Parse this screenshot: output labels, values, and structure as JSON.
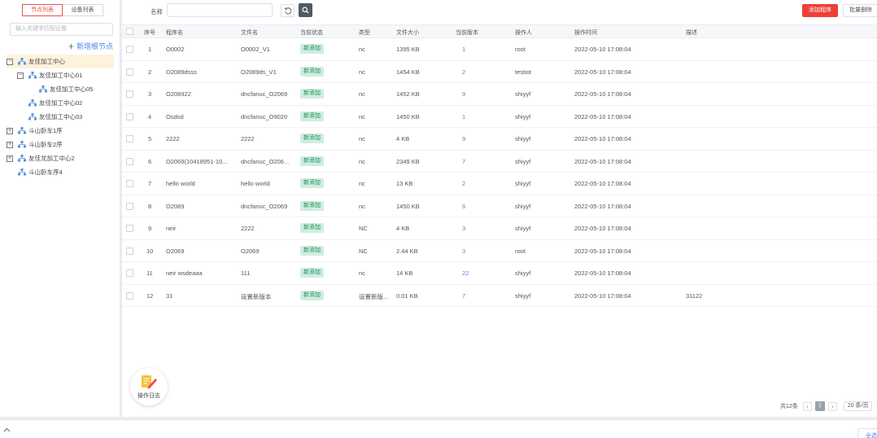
{
  "sidebar": {
    "tabs": [
      {
        "label": "节点列表",
        "active": true
      },
      {
        "label": "设备列表",
        "active": false
      }
    ],
    "search_placeholder": "输入关键字匹配设备",
    "add_root_label": "新增根节点",
    "tree": [
      {
        "label": "友佳加工中心",
        "level": 0,
        "toggle": "−",
        "selected": true
      },
      {
        "label": "友佳加工中心01",
        "level": 1,
        "toggle": "−",
        "selected": false
      },
      {
        "label": "友佳加工中心05",
        "level": 2,
        "toggle": "",
        "selected": false
      },
      {
        "label": "友佳加工中心02",
        "level": 1,
        "toggle": "",
        "selected": false
      },
      {
        "label": "友佳加工中心03",
        "level": 1,
        "toggle": "",
        "selected": false
      },
      {
        "label": "斗山卧车1序",
        "level": 0,
        "toggle": "+",
        "selected": false
      },
      {
        "label": "斗山卧车2序",
        "level": 0,
        "toggle": "+",
        "selected": false
      },
      {
        "label": "友佳龙加工中心2",
        "level": 0,
        "toggle": "+",
        "selected": false
      },
      {
        "label": "斗山卧车序4",
        "level": 0,
        "toggle": "",
        "selected": false
      }
    ]
  },
  "toolbar": {
    "name_label": "名称",
    "name_value": "",
    "add_program_label": "添加程序",
    "batch_delete_label": "批量删除"
  },
  "table": {
    "headers": [
      "序号",
      "程序名",
      "文件名",
      "当前状态",
      "类型",
      "文件大小",
      "当前版本",
      "操作人",
      "操作时间",
      "描述"
    ],
    "rows": [
      [
        "1",
        "O0002",
        "O0002_V1",
        "新添加",
        "nc",
        "1395 KB",
        "1",
        "root",
        "2022-05-10 17:08:04",
        ""
      ],
      [
        "2",
        "O2089dsss",
        "O2089ds_V1",
        "新添加",
        "nc",
        "1454 KB",
        "2",
        "testiot",
        "2022-05-10 17:08:04",
        ""
      ],
      [
        "3",
        "O208922",
        "dncfanuc_O2069",
        "新添加",
        "nc",
        "1452 KB",
        "9",
        "shiyyf",
        "2022-05-10 17:08:04",
        ""
      ],
      [
        "4",
        "Osdsd",
        "dncfanuc_O9020",
        "新添加",
        "nc",
        "1450 KB",
        "1",
        "shiyyf",
        "2022-05-10 17:08:04",
        ""
      ],
      [
        "5",
        "2222",
        "2222",
        "新添加",
        "nc",
        "4 KB",
        "9",
        "shiyyf",
        "2022-05-10 17:08:04",
        ""
      ],
      [
        "6",
        "O2069(10418951-10...",
        "dncfanuc_O206...",
        "新添加",
        "nc",
        "2349 KB",
        "7",
        "shiyyf",
        "2022-05-10 17:08:04",
        ""
      ],
      [
        "7",
        "hello world",
        "hello world",
        "新添加",
        "nc",
        "13 KB",
        "2",
        "shiyyf",
        "2022-05-10 17:08:04",
        ""
      ],
      [
        "8",
        "O2089",
        "dncfanuc_O2069",
        "新添加",
        "nc",
        "1450 KB",
        "6",
        "shiyyf",
        "2022-05-10 17:08:04",
        ""
      ],
      [
        "9",
        "neir",
        "2222",
        "新添加",
        "NC",
        "4 KB",
        "3",
        "shiyyf",
        "2022-05-10 17:08:04",
        ""
      ],
      [
        "10",
        "O2069",
        "O2069",
        "新添加",
        "NC",
        "2.44 KB",
        "3",
        "root",
        "2022-05-10 17:08:04",
        ""
      ],
      [
        "11",
        "neir wsdeaaa",
        "111",
        "新添加",
        "nc",
        "14 KB",
        "22",
        "shiyyf",
        "2022-05-10 17:08:04",
        ""
      ],
      [
        "12",
        "31",
        "设置新版本",
        "新添加",
        "设置新版...",
        "0.01 KB",
        "7",
        "shiyyf",
        "2022-05-10 17:08:04",
        "31122"
      ]
    ]
  },
  "log_button_label": "操作日志",
  "pagination": {
    "total_label": "共12条",
    "current_page": "1",
    "page_size_label": "20 条/页"
  },
  "bottom": {
    "corner_label": "全选"
  },
  "colors": {
    "accent_red": "#ee3f38",
    "link_blue": "#4a86e8",
    "badge_green_bg": "#cdeee0",
    "badge_green_text": "#1f8b5a",
    "selected_node_bg": "#fdf3dc"
  },
  "icons": {
    "tree_node": "org-tree-icon",
    "reset": "refresh-icon",
    "search": "search-icon",
    "log": "notepad-pen-icon",
    "collapse": "chevron-up-icon"
  }
}
